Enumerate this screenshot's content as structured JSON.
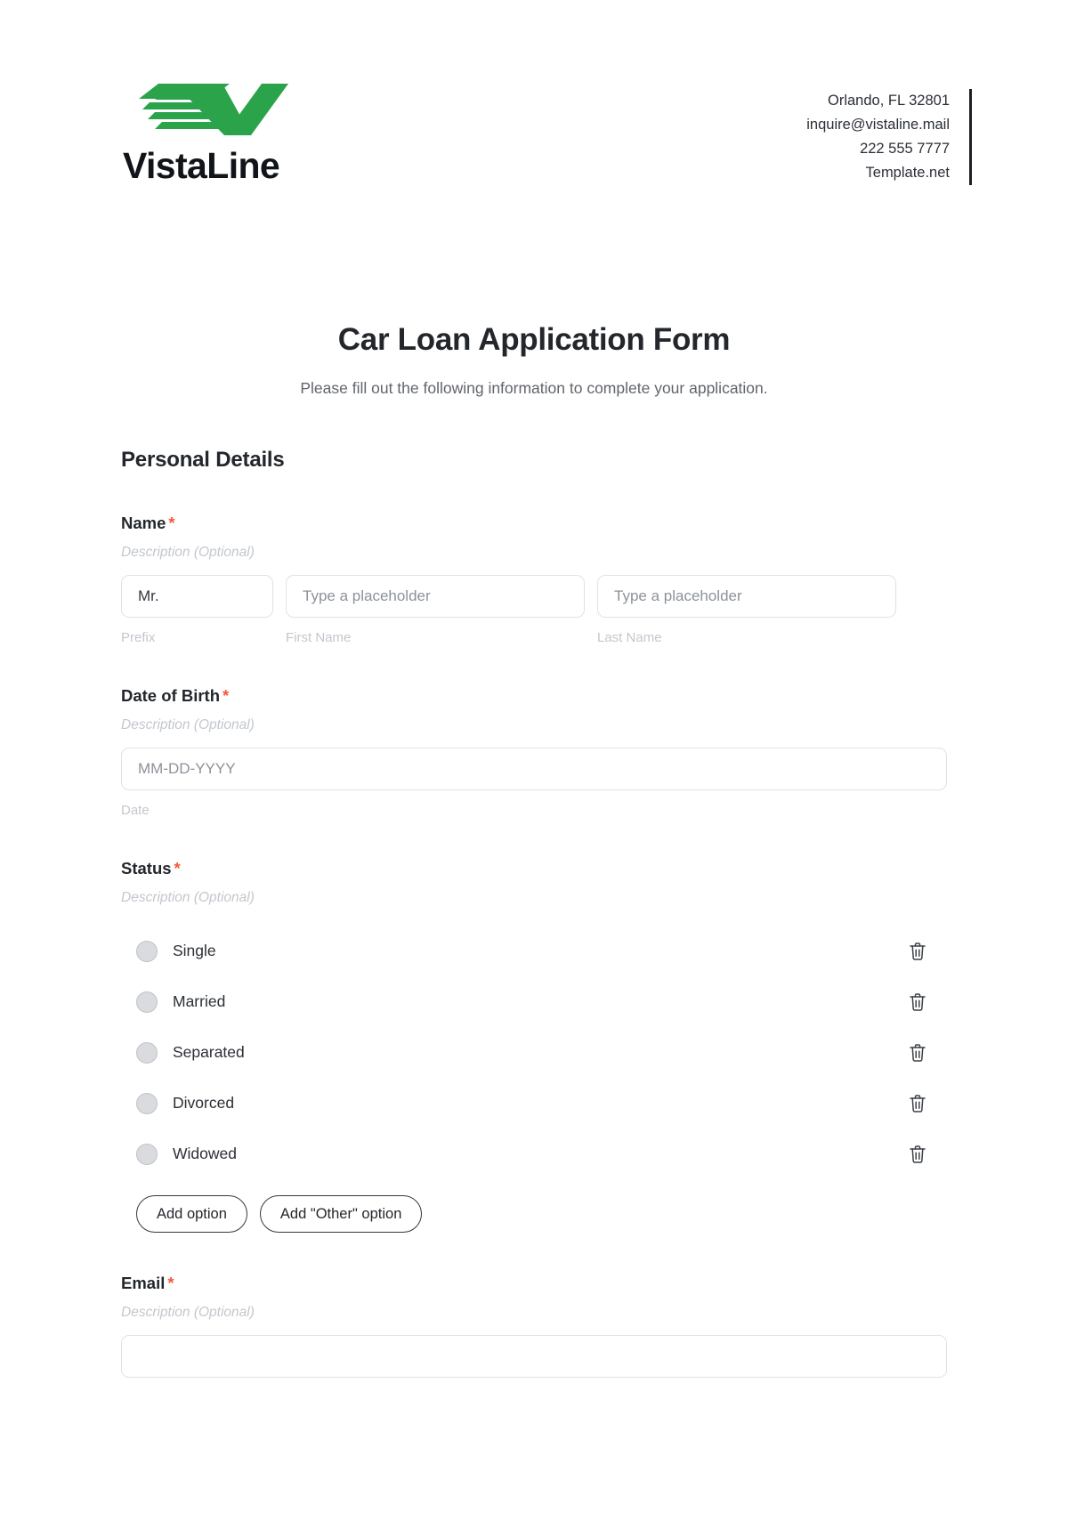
{
  "header": {
    "brand_name": "VistaLine",
    "logo_icon": "vistaline-wing-v-logo",
    "contact": {
      "address": "Orlando, FL 32801",
      "email": "inquire@vistaline.mail",
      "phone": "222 555 7777",
      "website": "Template.net"
    }
  },
  "title": {
    "heading": "Car Loan Application Form",
    "subheading": "Please fill out the following information to complete your application."
  },
  "section": {
    "heading": "Personal Details"
  },
  "fields": {
    "name": {
      "label": "Name",
      "required_marker": "*",
      "description": "Description (Optional)",
      "prefix": {
        "value": "Mr.",
        "sub_label": "Prefix"
      },
      "first_name": {
        "placeholder": "Type a placeholder",
        "sub_label": "First Name"
      },
      "last_name": {
        "placeholder": "Type a placeholder",
        "sub_label": "Last Name"
      }
    },
    "date_of_birth": {
      "label": "Date of Birth",
      "required_marker": "*",
      "description": "Description (Optional)",
      "placeholder": "MM-DD-YYYY",
      "sub_label": "Date"
    },
    "status": {
      "label": "Status",
      "required_marker": "*",
      "description": "Description (Optional)",
      "options": [
        {
          "label": "Single",
          "delete_icon": "trash-icon"
        },
        {
          "label": "Married",
          "delete_icon": "trash-icon"
        },
        {
          "label": "Separated",
          "delete_icon": "trash-icon"
        },
        {
          "label": "Divorced",
          "delete_icon": "trash-icon"
        },
        {
          "label": "Widowed",
          "delete_icon": "trash-icon"
        }
      ],
      "add_option_label": "Add option",
      "add_other_option_label": "Add \"Other\" option"
    },
    "email": {
      "label": "Email",
      "required_marker": "*",
      "description": "Description (Optional)"
    }
  },
  "colors": {
    "brand_green": "#2aa34a",
    "required_red": "#f2593e",
    "text_dark": "#23272c",
    "muted": "#c3c7cd"
  }
}
